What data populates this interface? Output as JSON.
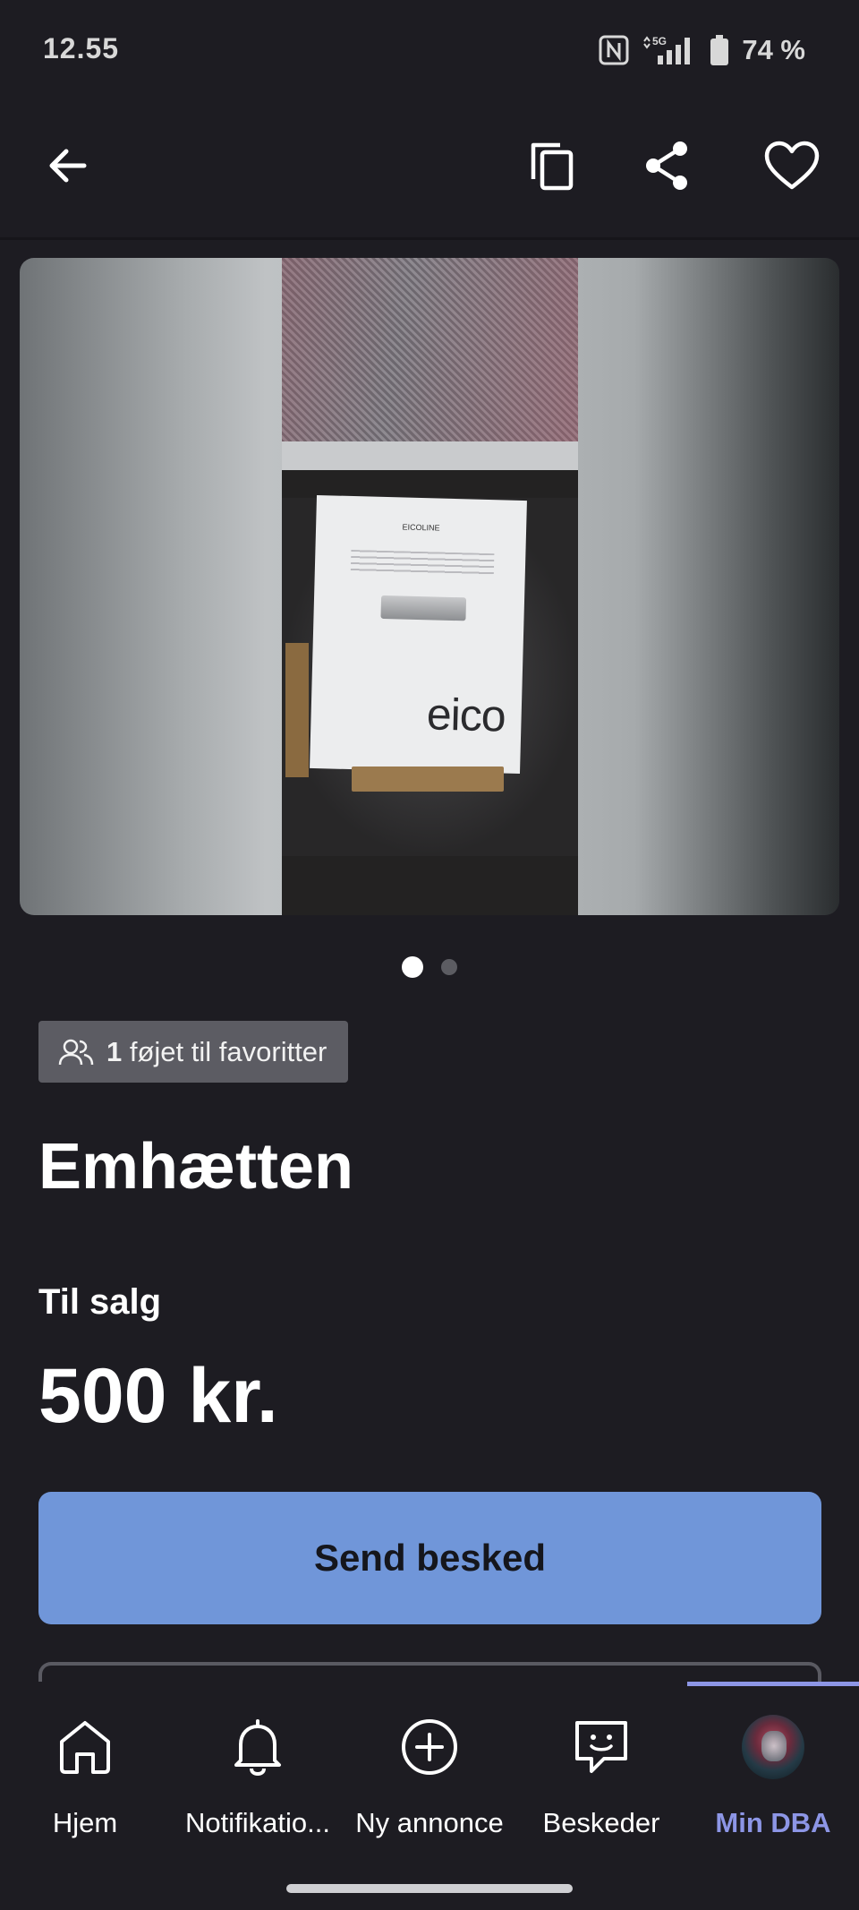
{
  "status_bar": {
    "time": "12.55",
    "battery": "74 %",
    "network": "5G",
    "icons": [
      "nfc-icon",
      "signal-icon",
      "battery-icon"
    ]
  },
  "app_bar": {
    "icons": [
      "back-arrow-icon",
      "copy-icon",
      "share-icon",
      "heart-icon"
    ]
  },
  "gallery": {
    "image_logo_text": "eico",
    "image_manual_title": "EICOLINE",
    "page_count": 2,
    "current_page": 1
  },
  "listing": {
    "favorites_count": "1",
    "favorites_text": "føjet til favoritter",
    "title": "Emhætten",
    "sale_label": "Til salg",
    "price": "500 kr."
  },
  "actions": {
    "send_message": "Send besked"
  },
  "bottom_nav": {
    "items": [
      {
        "label": "Hjem",
        "icon": "home-icon"
      },
      {
        "label": "Notifikatio...",
        "icon": "bell-icon"
      },
      {
        "label": "Ny annonce",
        "icon": "plus-circle-icon"
      },
      {
        "label": "Beskeder",
        "icon": "chat-icon"
      },
      {
        "label": "Min DBA",
        "icon": "avatar"
      }
    ],
    "active": "Min DBA",
    "active_color": "#8d96e6"
  },
  "colors": {
    "background": "#1d1c22",
    "primary_button": "#7096d9",
    "chip": "#5c5c63"
  }
}
